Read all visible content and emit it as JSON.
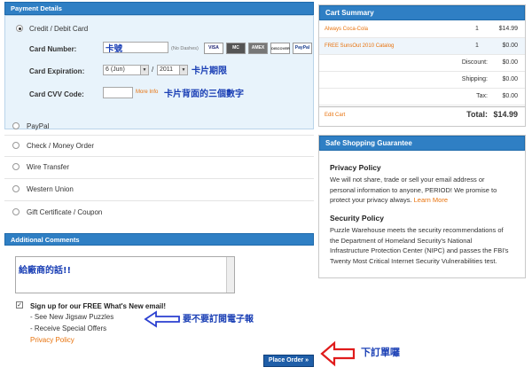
{
  "payment": {
    "header": "Payment Details",
    "credit_option": "Credit / Debit Card",
    "card_number_label": "Card Number:",
    "card_number_value": "卡號",
    "no_dashes": "(No Dashes)",
    "card_logos": [
      "VISA",
      "MC",
      "AMEX",
      "DISCOVER",
      "PayPal"
    ],
    "expiration_label": "Card Expiration:",
    "exp_month": "6 (Jun)",
    "exp_year": "2011",
    "exp_slash": "/",
    "exp_annotation": "卡片期限",
    "cvv_label": "Card CVV Code:",
    "more_info": "More Info",
    "cvv_annotation": "卡片背面的三個數字",
    "other_options": [
      "PayPal",
      "Check / Money Order",
      "Wire Transfer",
      "Western Union",
      "Gift Certificate / Coupon"
    ]
  },
  "comments": {
    "header": "Additional Comments",
    "text": "給廠商的話!!",
    "signup_label": "Sign up for our FREE What's New email!",
    "bullets": [
      "- See New Jigsaw Puzzles",
      "- Receive Special Offers"
    ],
    "privacy_link": "Privacy Policy",
    "signup_annotation": "要不要訂閱電子報"
  },
  "cart": {
    "header": "Cart Summary",
    "items": [
      {
        "name": "Always Coca-Cola",
        "qty": "1",
        "price": "$14.99"
      },
      {
        "name": "FREE SunsOut 2010 Catalog",
        "qty": "1",
        "price": "$0.00"
      }
    ],
    "discount_label": "Discount:",
    "discount": "$0.00",
    "shipping_label": "Shipping:",
    "shipping": "$0.00",
    "tax_label": "Tax:",
    "tax": "$0.00",
    "edit_cart": "Edit Cart",
    "total_label": "Total:",
    "total": "$14.99"
  },
  "guarantee": {
    "header": "Safe Shopping Guarantee",
    "privacy_title": "Privacy Policy",
    "privacy_lines": [
      "We will not share, trade or sell your email address or",
      "personal information to anyone, PERIOD! We promise to",
      "protect your privacy always."
    ],
    "learn_more": "Learn More",
    "security_title": "Security Policy",
    "security_lines": [
      "Puzzle Warehouse meets the security recommendations of",
      "the Department of Homeland Security's National",
      "Infrastructure Protection Center (NIPC) and passes the FBI's",
      "Twenty Most Critical Internet Security Vulnerabilities test."
    ]
  },
  "place_order": "Place Order »",
  "place_order_annotation": "下訂單囉",
  "colors": {
    "header_blue": "#2f7fc4",
    "link_orange": "#e8720c",
    "annotation_blue": "#1a3fb5",
    "arrow_red": "#e01b1b"
  }
}
